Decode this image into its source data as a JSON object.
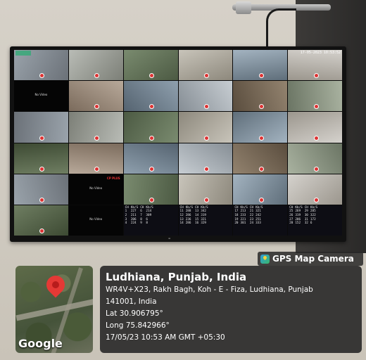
{
  "badge": {
    "label": "GPS Map Camera",
    "icon": "gps-map-camera-icon"
  },
  "map": {
    "brand": "Google"
  },
  "location": {
    "city": "Ludhiana, Punjab, India",
    "address": "WR4V+X23, Rakh Bagh, Koh - E - Fiza, Ludhiana, Punjab",
    "postal": "141001, India",
    "lat": "Lat 30.906795°",
    "long": "Long 75.842966°",
    "datetime": "17/05/23 10:53 AM GMT +05:30"
  },
  "cctv": {
    "timestamp": "17-05-2023 10:53:52",
    "brand_tag": "CP PLUS",
    "no_video_text": "No Video",
    "stats_header": [
      "CH",
      "Kb/S",
      "CH",
      "Kb/S"
    ],
    "stats": [
      [
        "1",
        "227",
        "6",
        "214"
      ],
      [
        "2",
        "211",
        "7",
        "309"
      ],
      [
        "3",
        "206",
        "8",
        "6"
      ],
      [
        "4",
        "224",
        "9",
        "8"
      ],
      [
        "11",
        "288",
        "13",
        "342"
      ],
      [
        "12",
        "286",
        "14",
        "319"
      ],
      [
        "13",
        "236",
        "15",
        "321"
      ],
      [
        "14",
        "286",
        "16",
        "329"
      ],
      [
        "17",
        "213",
        "21",
        "321"
      ],
      [
        "18",
        "233",
        "22",
        "242"
      ],
      [
        "19",
        "221",
        "23",
        "251"
      ],
      [
        "20",
        "301",
        "24",
        "333"
      ],
      [
        "25",
        "269",
        "29",
        "285"
      ],
      [
        "26",
        "319",
        "30",
        "322"
      ],
      [
        "27",
        "206",
        "31",
        "172"
      ],
      [
        "28",
        "152",
        "32",
        "6"
      ]
    ]
  },
  "colors": {
    "pin": "#e53935",
    "dot": "#dd3333"
  }
}
